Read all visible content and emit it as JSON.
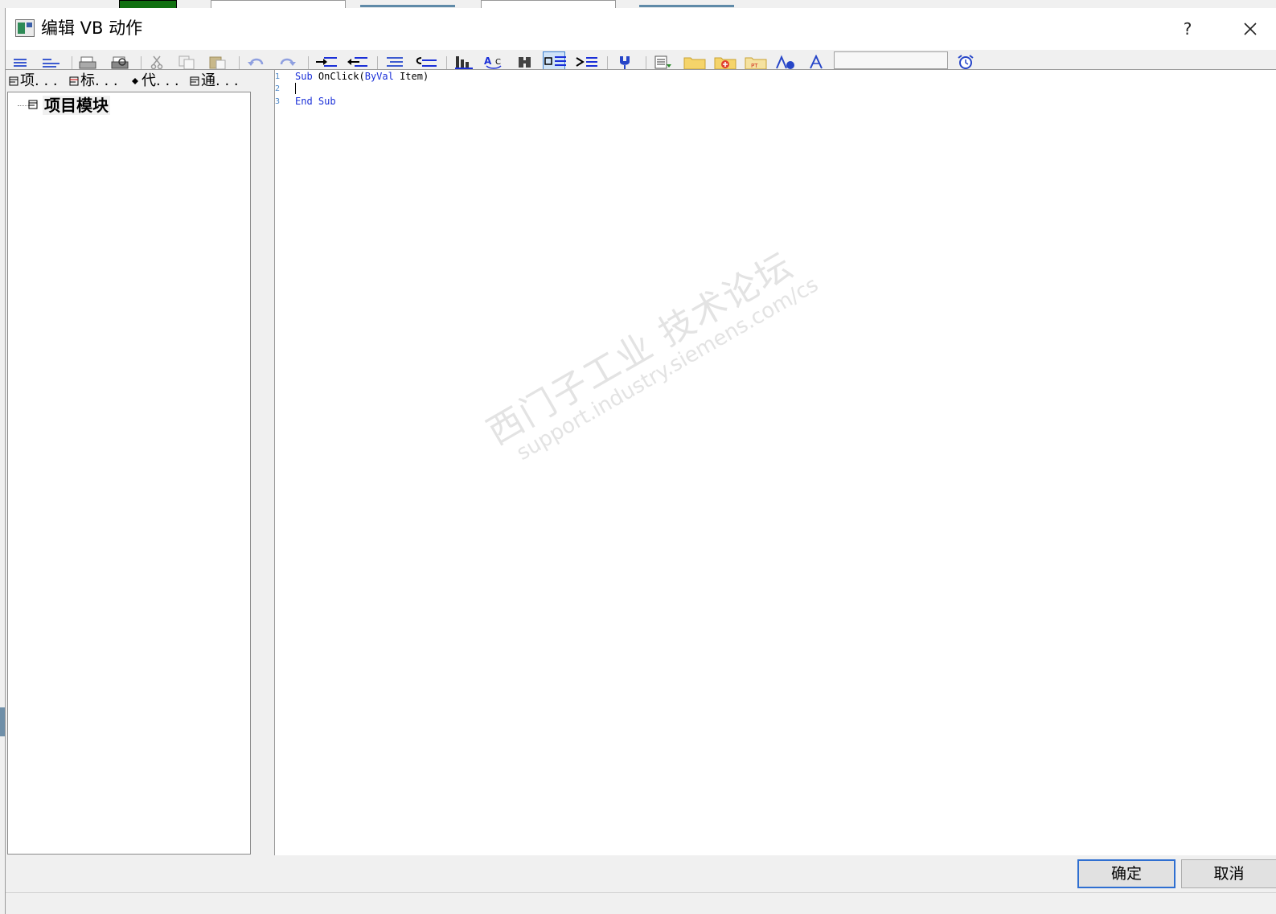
{
  "window": {
    "title": "编辑 VB 动作",
    "help_label": "?"
  },
  "toolbar": {
    "icons": [
      "indent-icon",
      "outdent-icon",
      "print-icon",
      "print-preview-icon",
      "cut-icon",
      "copy-icon",
      "paste-icon",
      "undo-icon",
      "redo-icon",
      "increase-indent-icon",
      "decrease-indent-icon",
      "comment-icon",
      "uncomment-icon",
      "bookmark-icon",
      "find-replace-icon",
      "find-icon",
      "toggle-bookmark-icon",
      "next-bookmark-icon",
      "syntax-check-icon",
      "insert-object-icon",
      "folder-icon",
      "add-folder-icon",
      "tag-folder-icon",
      "object-browser-icon",
      "compass-icon",
      "trigger-clock-icon"
    ],
    "search_value": ""
  },
  "left_tabs": [
    {
      "label": "项. . ."
    },
    {
      "label": "标. . ."
    },
    {
      "label": "代. . ."
    },
    {
      "label": "通. . ."
    }
  ],
  "tree": {
    "root_label": "项目模块"
  },
  "editor": {
    "line_numbers": [
      "1",
      "2",
      "3"
    ],
    "line1": {
      "kw1": "Sub",
      "t1": " OnClick(",
      "kw2": "ByVal",
      "t2": " Item)"
    },
    "line3": {
      "kw1": "End",
      "t1": " ",
      "kw2": "Sub"
    }
  },
  "watermark": {
    "cn": "西门子工业 技术论坛",
    "url": "support.industry.siemens.com/cs"
  },
  "buttons": {
    "ok": "确定",
    "cancel": "取消"
  },
  "colors": {
    "keyword": "#1a2fd8",
    "line_number": "#4a86c8",
    "dialog_bg": "#f0f0f0",
    "default_button_border": "#2f6fd1"
  }
}
